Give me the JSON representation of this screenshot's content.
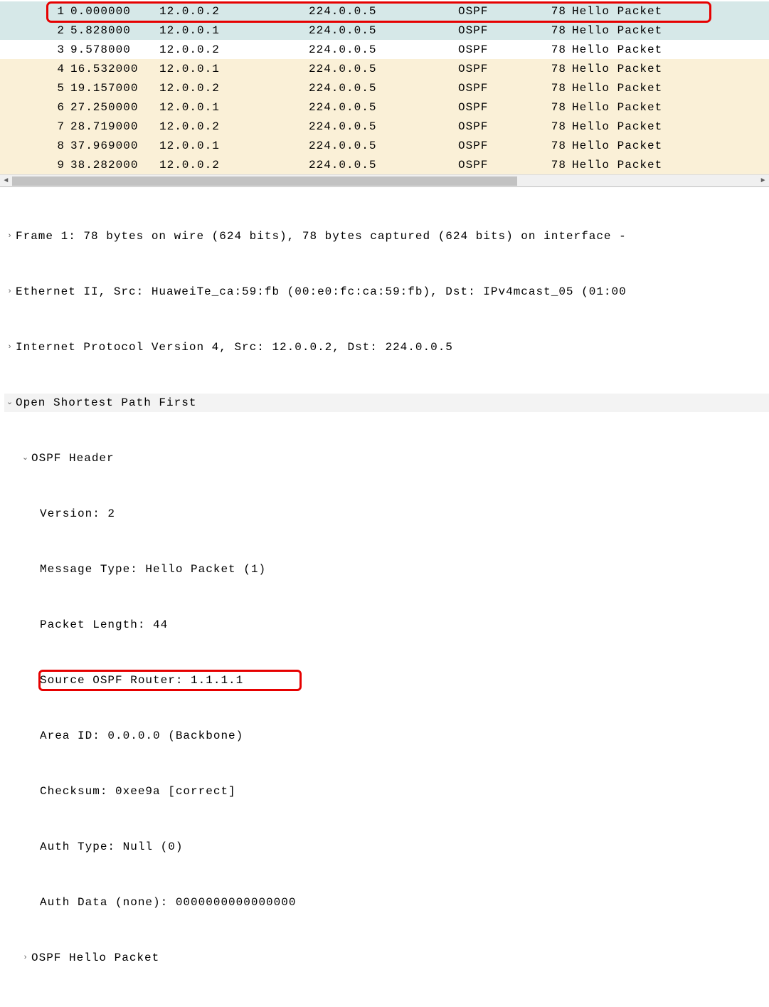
{
  "packets": [
    {
      "no": "1",
      "time": "0.000000",
      "src": "12.0.0.2",
      "dst": "224.0.0.5",
      "proto": "OSPF",
      "len": "78",
      "info": "Hello Packet",
      "cls": "row-selected"
    },
    {
      "no": "2",
      "time": "5.828000",
      "src": "12.0.0.1",
      "dst": "224.0.0.5",
      "proto": "OSPF",
      "len": "78",
      "info": "Hello Packet",
      "cls": "row-selected"
    },
    {
      "no": "3",
      "time": "9.578000",
      "src": "12.0.0.2",
      "dst": "224.0.0.5",
      "proto": "OSPF",
      "len": "78",
      "info": "Hello Packet",
      "cls": "row-normal"
    },
    {
      "no": "4",
      "time": "16.532000",
      "src": "12.0.0.1",
      "dst": "224.0.0.5",
      "proto": "OSPF",
      "len": "78",
      "info": "Hello Packet",
      "cls": "row-alt"
    },
    {
      "no": "5",
      "time": "19.157000",
      "src": "12.0.0.2",
      "dst": "224.0.0.5",
      "proto": "OSPF",
      "len": "78",
      "info": "Hello Packet",
      "cls": "row-alt"
    },
    {
      "no": "6",
      "time": "27.250000",
      "src": "12.0.0.1",
      "dst": "224.0.0.5",
      "proto": "OSPF",
      "len": "78",
      "info": "Hello Packet",
      "cls": "row-alt"
    },
    {
      "no": "7",
      "time": "28.719000",
      "src": "12.0.0.2",
      "dst": "224.0.0.5",
      "proto": "OSPF",
      "len": "78",
      "info": "Hello Packet",
      "cls": "row-alt"
    },
    {
      "no": "8",
      "time": "37.969000",
      "src": "12.0.0.1",
      "dst": "224.0.0.5",
      "proto": "OSPF",
      "len": "78",
      "info": "Hello Packet",
      "cls": "row-alt"
    },
    {
      "no": "9",
      "time": "38.282000",
      "src": "12.0.0.2",
      "dst": "224.0.0.5",
      "proto": "OSPF",
      "len": "78",
      "info": "Hello Packet",
      "cls": "row-alt"
    }
  ],
  "details": {
    "frame": "Frame 1: 78 bytes on wire (624 bits), 78 bytes captured (624 bits) on interface -",
    "eth": "Ethernet II, Src: HuaweiTe_ca:59:fb (00:e0:fc:ca:59:fb), Dst: IPv4mcast_05 (01:00",
    "ip": "Internet Protocol Version 4, Src: 12.0.0.2, Dst: 224.0.0.5",
    "ospf": "Open Shortest Path First",
    "header": "OSPF Header",
    "version": "Version: 2",
    "msgtype": "Message Type: Hello Packet (1)",
    "pktlen": "Packet Length: 44",
    "srcrtr": "Source OSPF Router: 1.1.1.1",
    "area": "Area ID: 0.0.0.0 (Backbone)",
    "cksum": "Checksum: 0xee9a [correct]",
    "authtype": "Auth Type: Null (0)",
    "authdata": "Auth Data (none): 0000000000000000",
    "hello": "OSPF Hello Packet"
  },
  "glyphs": {
    "collapsed": "›",
    "expanded": "⌄",
    "arrow_left": "◄",
    "arrow_right": "►"
  }
}
